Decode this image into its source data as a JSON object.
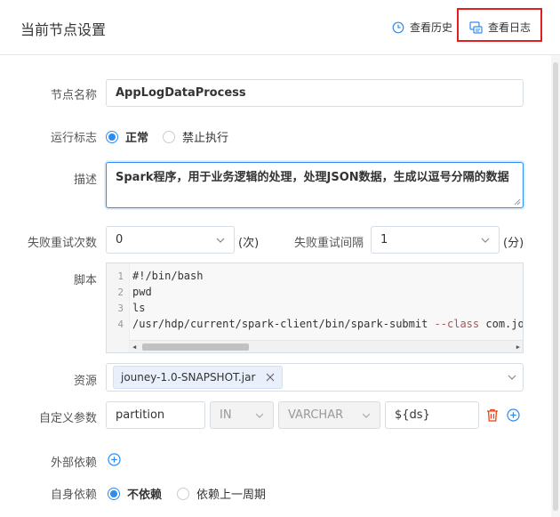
{
  "header": {
    "title": "当前节点设置",
    "history_label": "查看历史",
    "log_label": "查看日志"
  },
  "form": {
    "node_name": {
      "label": "节点名称",
      "value": "AppLogDataProcess"
    },
    "run_flag": {
      "label": "运行标志",
      "options": [
        "正常",
        "禁止执行"
      ],
      "selected": "正常"
    },
    "description": {
      "label": "描述",
      "value": "Spark程序，用于业务逻辑的处理，处理JSON数据，生成以逗号分隔的数据"
    },
    "retry_count": {
      "label": "失败重试次数",
      "value": "0",
      "unit": "(次)"
    },
    "retry_interval": {
      "label": "失败重试间隔",
      "value": "1",
      "unit": "(分)"
    },
    "script": {
      "label": "脚本",
      "lines": [
        {
          "num": "1",
          "text": "#!/bin/bash"
        },
        {
          "num": "2",
          "text": "pwd"
        },
        {
          "num": "3",
          "text": "ls"
        },
        {
          "num": "4",
          "text": "/usr/hdp/current/spark-client/bin/spark-submit --class com.journey.b"
        }
      ]
    },
    "resource": {
      "label": "资源",
      "tag": "jouney-1.0-SNAPSHOT.jar"
    },
    "custom_param": {
      "label": "自定义参数",
      "name": "partition",
      "direction": "IN",
      "type": "VARCHAR",
      "value": "${ds}"
    },
    "external_dep": {
      "label": "外部依赖"
    },
    "self_dep": {
      "label": "自身依赖",
      "options": [
        "不依赖",
        "依赖上一周期"
      ],
      "selected": "不依赖"
    }
  },
  "colors": {
    "accent": "#2d8cf0",
    "highlight": "#e02020",
    "delete": "#ed4014"
  }
}
